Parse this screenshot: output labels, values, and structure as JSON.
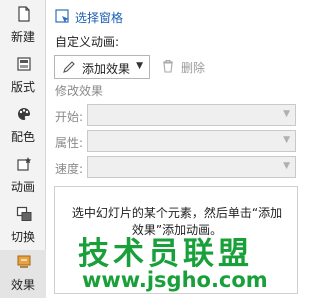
{
  "sidebar": {
    "items": [
      {
        "label": "新建",
        "icon": "new-icon"
      },
      {
        "label": "版式",
        "icon": "layout-icon"
      },
      {
        "label": "配色",
        "icon": "palette-icon"
      },
      {
        "label": "动画",
        "icon": "animation-icon"
      },
      {
        "label": "切换",
        "icon": "transition-icon"
      },
      {
        "label": "效果",
        "icon": "effects-icon",
        "active": true
      }
    ]
  },
  "panel": {
    "selection_pane": "选择窗格",
    "custom_animation": "自定义动画:",
    "add_effect": "添加效果",
    "delete": "删除",
    "modify_effect": "修改效果",
    "fields": {
      "start": "开始:",
      "property": "属性:",
      "speed": "速度:"
    },
    "info_text": "选中幻灯片的某个元素，然后单击“添加效果”添加动画。"
  },
  "watermark": {
    "title": "技术员联盟",
    "url": "www.jsgho.com"
  },
  "colors": {
    "watermark": "#19a03a",
    "link": "#1a5fb4"
  }
}
